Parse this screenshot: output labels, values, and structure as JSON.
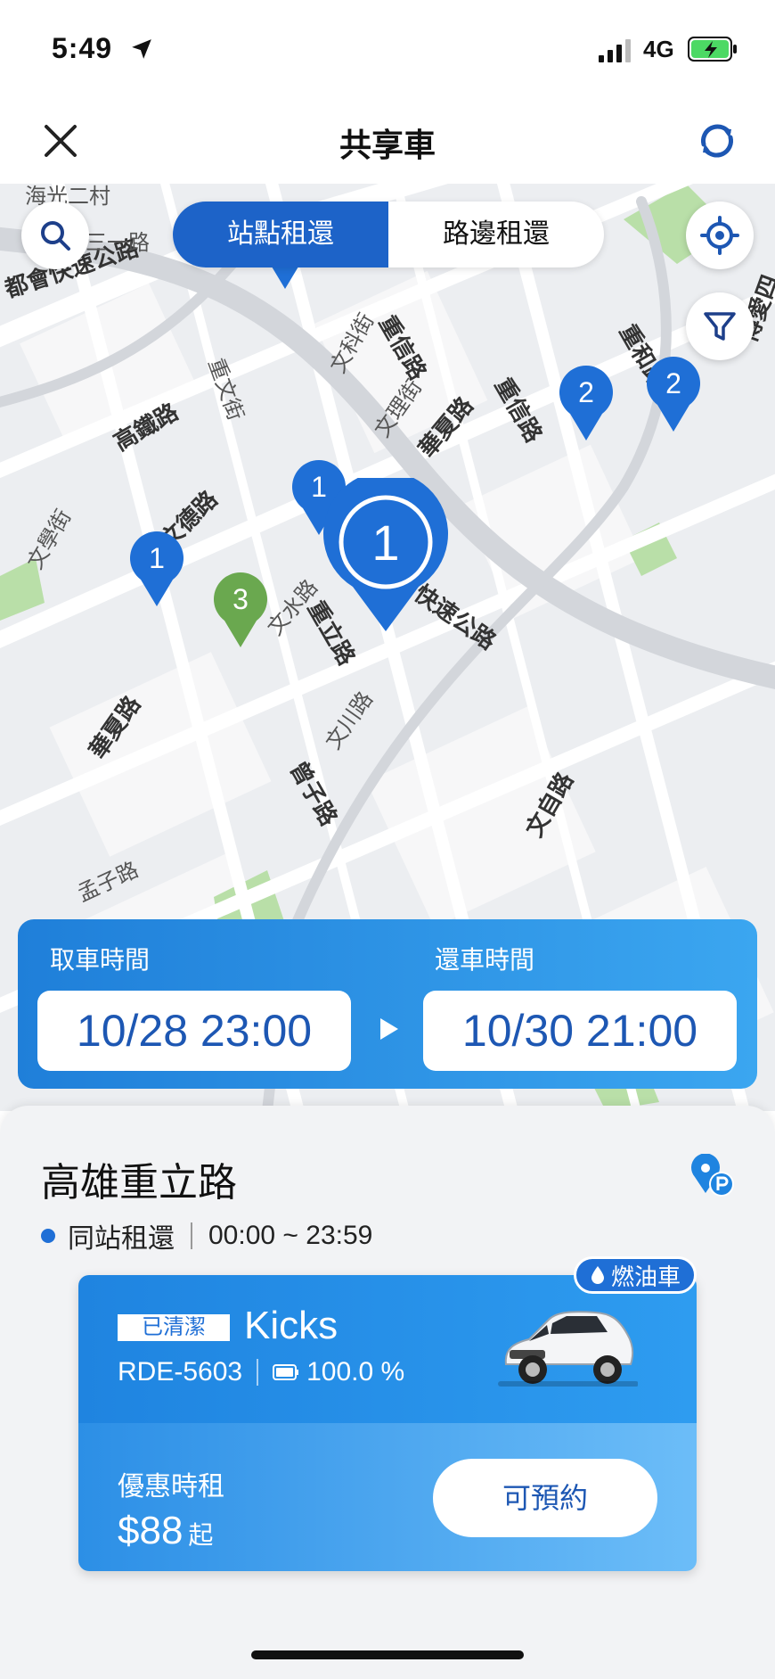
{
  "status_bar": {
    "time": "5:49",
    "network": "4G"
  },
  "header": {
    "title": "共享車"
  },
  "map": {
    "mode_tabs": [
      {
        "label": "站點租還",
        "active": true
      },
      {
        "label": "路邊租還",
        "active": false
      }
    ],
    "street_labels": [
      "海光二村",
      "都會快速公路",
      "高鐵路",
      "重信路",
      "文科街",
      "文理街",
      "華夏路",
      "重文街",
      "重和路",
      "博愛四",
      "文德路",
      "文水路",
      "重立路",
      "快速公路",
      "文學街",
      "華夏路",
      "文川路",
      "曾子路",
      "文自路",
      "孟子路",
      "三一路"
    ],
    "pins": [
      {
        "count": "3",
        "color": "blue"
      },
      {
        "count": "2",
        "color": "blue"
      },
      {
        "count": "2",
        "color": "blue"
      },
      {
        "count": "1",
        "color": "blue"
      },
      {
        "count": "1",
        "color": "blue"
      },
      {
        "count": "3",
        "color": "green"
      },
      {
        "count": "1",
        "color": "blue",
        "selected": true
      }
    ]
  },
  "rental_time": {
    "pickup_label": "取車時間",
    "pickup_value": "10/28 23:00",
    "return_label": "還車時間",
    "return_value": "10/30 21:00"
  },
  "station": {
    "name": "高雄重立路",
    "mode": "同站租還",
    "hours": "00:00 ~ 23:59"
  },
  "car": {
    "fuel_tag": "燃油車",
    "clean_badge": "已清潔",
    "model": "Kicks",
    "plate": "RDE-5603",
    "battery": "100.0 %",
    "promo_label": "優惠時租",
    "price": "$88",
    "price_unit": "起",
    "book_label": "可預約"
  },
  "colors": {
    "primary": "#1f6fd6",
    "pin_green": "#6aa84f",
    "accent_dark": "#1d57b3"
  }
}
